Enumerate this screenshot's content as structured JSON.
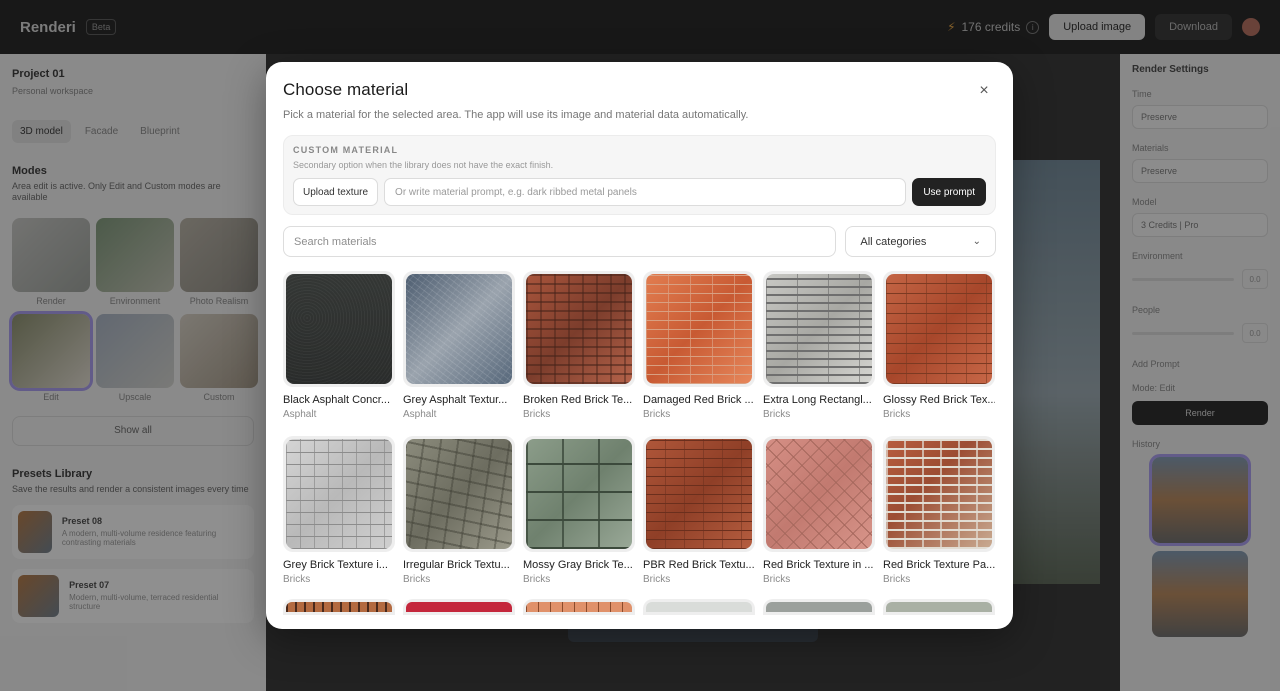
{
  "app": {
    "brand": "Renderi",
    "badge": "Beta",
    "credits": "176 credits",
    "upload_label": "Upload image",
    "download_label": "Download"
  },
  "left_panel": {
    "project_name": "Project 01",
    "project_sub": "Personal workspace",
    "tabs": [
      "3D model",
      "Facade",
      "Blueprint"
    ],
    "modes_title": "Modes",
    "modes_note": "Area edit is active. Only Edit and Custom modes are available",
    "modes": [
      "Render",
      "Environment",
      "Photo Realism",
      "Edit",
      "Upscale",
      "Custom"
    ],
    "show_all": "Show all",
    "presets_title": "Presets Library",
    "presets_note": "Save the results and render a consistent images every time",
    "presets": [
      {
        "title": "Preset 08",
        "desc": "A modern, multi-volume residence featuring contrasting materials"
      },
      {
        "title": "Preset 07",
        "desc": "Modern, multi-volume, terraced residential structure"
      }
    ]
  },
  "right_panel": {
    "title": "Render Settings",
    "time_label": "Time",
    "time_value": "Preserve",
    "materials_label": "Materials",
    "materials_value": "Preserve",
    "model_label": "Model",
    "model_value": "3 Credits | Pro",
    "environment_label": "Environment",
    "environment_value": "0.0",
    "people_label": "People",
    "people_value": "0.0",
    "add_prompt": "Add Prompt",
    "mode_label": "Mode: Edit",
    "render_label": "Render",
    "history_label": "History"
  },
  "modal": {
    "title": "Choose material",
    "close_symbol": "×",
    "subtitle": "Pick a material for the selected area. The app will use its image and material data automatically.",
    "custom": {
      "heading": "CUSTOM MATERIAL",
      "sub": "Secondary option when the library does not have the exact finish.",
      "upload_label": "Upload texture",
      "prompt_placeholder": "Or write material prompt, e.g. dark ribbed metal panels",
      "use_prompt_label": "Use prompt"
    },
    "search_placeholder": "Search materials",
    "category_value": "All categories",
    "materials_row1": [
      {
        "name": "Black Asphalt Concr...",
        "category": "Asphalt",
        "texture": "t-asphalt-black"
      },
      {
        "name": "Grey Asphalt Textur...",
        "category": "Asphalt",
        "texture": "t-asphalt-grey"
      },
      {
        "name": "Broken Red Brick Te...",
        "category": "Bricks",
        "texture": "t-broken-brick"
      },
      {
        "name": "Damaged Red Brick ...",
        "category": "Bricks",
        "texture": "t-damaged-brick"
      },
      {
        "name": "Extra Long Rectangl...",
        "category": "Bricks",
        "texture": "t-stone-strip"
      },
      {
        "name": "Glossy Red Brick Tex...",
        "category": "Bricks",
        "texture": "t-glossy-brick"
      }
    ],
    "materials_row2": [
      {
        "name": "Grey Brick Texture i...",
        "category": "Bricks",
        "texture": "t-grey-brick"
      },
      {
        "name": "Irregular Brick Textu...",
        "category": "Bricks",
        "texture": "t-irregular"
      },
      {
        "name": "Mossy Gray Brick Te...",
        "category": "Bricks",
        "texture": "t-mossy"
      },
      {
        "name": "PBR Red Brick Textu...",
        "category": "Bricks",
        "texture": "t-pbr-brick"
      },
      {
        "name": "Red Brick Texture in ...",
        "category": "Bricks",
        "texture": "t-red-herring"
      },
      {
        "name": "Red Brick Texture Pa...",
        "category": "Bricks",
        "texture": "t-red-pattern"
      }
    ],
    "materials_row3_textures": [
      "t-r3a",
      "t-r3b",
      "t-r3c",
      "t-r3d",
      "t-r3e",
      "t-r3f"
    ]
  }
}
